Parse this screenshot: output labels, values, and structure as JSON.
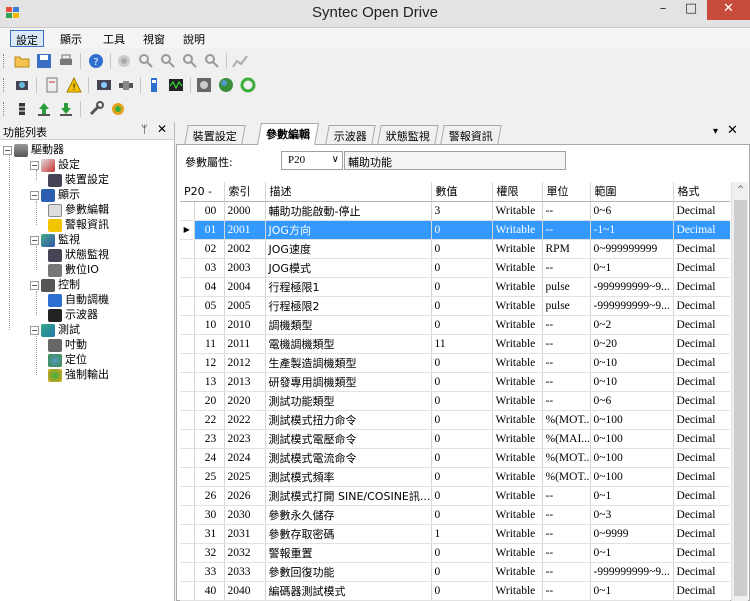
{
  "window": {
    "title": "Syntec Open Drive",
    "minimize": "–",
    "maximize": "□",
    "close": "✕"
  },
  "menu": [
    {
      "label": "設定",
      "active": true
    },
    {
      "label": "顯示"
    },
    {
      "label": "工具"
    },
    {
      "label": "視窗"
    },
    {
      "label": "說明"
    }
  ],
  "left_panel": {
    "title": "功能列表",
    "pin": "ᛘ",
    "close": "✕",
    "tree": [
      {
        "label": "驅動器",
        "icon": "drive-icon",
        "exp": "−"
      },
      {
        "label": "設定",
        "icon": "settings-icon",
        "exp": "−"
      },
      {
        "label": "裝置設定",
        "icon": "device-settings-icon"
      },
      {
        "label": "顯示",
        "icon": "display-icon",
        "exp": "−"
      },
      {
        "label": "參數編輯",
        "icon": "param-edit-icon"
      },
      {
        "label": "警報資訊",
        "icon": "alarm-info-icon"
      },
      {
        "label": "監視",
        "icon": "monitor-icon",
        "exp": "−"
      },
      {
        "label": "狀態監視",
        "icon": "status-monitor-icon"
      },
      {
        "label": "數位IO",
        "icon": "digital-io-icon"
      },
      {
        "label": "控制",
        "icon": "control-icon",
        "exp": "−"
      },
      {
        "label": "自動調機",
        "icon": "auto-tune-icon"
      },
      {
        "label": "示波器",
        "icon": "oscilloscope-icon"
      },
      {
        "label": "測試",
        "icon": "test-icon",
        "exp": "−"
      },
      {
        "label": "吋動",
        "icon": "jog-icon"
      },
      {
        "label": "定位",
        "icon": "position-icon"
      },
      {
        "label": "強制輸出",
        "icon": "force-output-icon"
      }
    ]
  },
  "tabs": [
    {
      "label": "裝置設定"
    },
    {
      "label": "參數編輯",
      "active": true
    },
    {
      "label": "示波器"
    },
    {
      "label": "狀態監視"
    },
    {
      "label": "警報資訊"
    }
  ],
  "tab_menu": "▾",
  "tab_close": "✕",
  "param_attr": {
    "label": "參數屬性:",
    "selected": "P20",
    "arrow": "∨",
    "description": "輔助功能"
  },
  "grid": {
    "columns": [
      "P20 -",
      "索引",
      "描述",
      "數值",
      "權限",
      "單位",
      "範圍",
      "格式"
    ],
    "selected_marker": "▶",
    "rows": [
      [
        "00",
        "2000",
        "輔助功能啟動-停止",
        "3",
        "Writable",
        "--",
        "0~6",
        "Decimal"
      ],
      [
        "01",
        "2001",
        "JOG方向",
        "0",
        "Writable",
        "--",
        "-1~1",
        "Decimal"
      ],
      [
        "02",
        "2002",
        "JOG速度",
        "0",
        "Writable",
        "RPM",
        "0~999999999",
        "Decimal"
      ],
      [
        "03",
        "2003",
        "JOG模式",
        "0",
        "Writable",
        "--",
        "0~1",
        "Decimal"
      ],
      [
        "04",
        "2004",
        "行程極限1",
        "0",
        "Writable",
        "pulse",
        "-999999999~9...",
        "Decimal"
      ],
      [
        "05",
        "2005",
        "行程極限2",
        "0",
        "Writable",
        "pulse",
        "-999999999~9...",
        "Decimal"
      ],
      [
        "10",
        "2010",
        "調機類型",
        "0",
        "Writable",
        "--",
        "0~2",
        "Decimal"
      ],
      [
        "11",
        "2011",
        "電機調機類型",
        "11",
        "Writable",
        "--",
        "0~20",
        "Decimal"
      ],
      [
        "12",
        "2012",
        "生產製造調機類型",
        "0",
        "Writable",
        "--",
        "0~10",
        "Decimal"
      ],
      [
        "13",
        "2013",
        "研發專用調機類型",
        "0",
        "Writable",
        "--",
        "0~10",
        "Decimal"
      ],
      [
        "20",
        "2020",
        "測試功能類型",
        "0",
        "Writable",
        "--",
        "0~6",
        "Decimal"
      ],
      [
        "22",
        "2022",
        "測試模式扭力命令",
        "0",
        "Writable",
        "%(MOT...",
        "0~100",
        "Decimal"
      ],
      [
        "23",
        "2023",
        "測試模式電壓命令",
        "0",
        "Writable",
        "%(MAI...",
        "0~100",
        "Decimal"
      ],
      [
        "24",
        "2024",
        "測試模式電流命令",
        "0",
        "Writable",
        "%(MOT...",
        "0~100",
        "Decimal"
      ],
      [
        "25",
        "2025",
        "測試模式頻率",
        "0",
        "Writable",
        "%(MOT...",
        "0~100",
        "Decimal"
      ],
      [
        "26",
        "2026",
        "測試模式打開 SINE/COSINE訊...",
        "0",
        "Writable",
        "--",
        "0~1",
        "Decimal"
      ],
      [
        "30",
        "2030",
        "參數永久儲存",
        "0",
        "Writable",
        "--",
        "0~3",
        "Decimal"
      ],
      [
        "31",
        "2031",
        "參數存取密碼",
        "1",
        "Writable",
        "--",
        "0~9999",
        "Decimal"
      ],
      [
        "32",
        "2032",
        "警報重置",
        "0",
        "Writable",
        "--",
        "0~1",
        "Decimal"
      ],
      [
        "33",
        "2033",
        "參數回復功能",
        "0",
        "Writable",
        "--",
        "-999999999~9...",
        "Decimal"
      ],
      [
        "40",
        "2040",
        "編碼器測試模式",
        "0",
        "Writable",
        "--",
        "0~1",
        "Decimal"
      ]
    ],
    "selected_row": 1
  },
  "scroll_up": "^"
}
